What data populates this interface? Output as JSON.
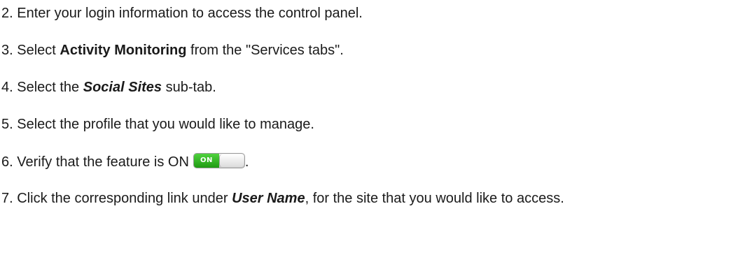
{
  "steps": {
    "s2": {
      "text": "2. Enter your login information to access the control panel."
    },
    "s3": {
      "pre": "3. Select ",
      "bold": "Activity Monitoring",
      "post": " from the \"Services tabs\"."
    },
    "s4": {
      "pre": "4. Select the ",
      "bold": "Social Sites",
      "post": " sub-tab."
    },
    "s5": {
      "text": "5. Select the profile that you would like to manage."
    },
    "s6": {
      "pre": "6. Verify that the feature is ON",
      "post": "."
    },
    "s7": {
      "pre": "7. Click the corresponding link under ",
      "bold": "User Name",
      "post": ", for the site that you would like to access."
    }
  },
  "toggle": {
    "label": "ON",
    "state": "on",
    "on_color": "#2bb01c"
  }
}
